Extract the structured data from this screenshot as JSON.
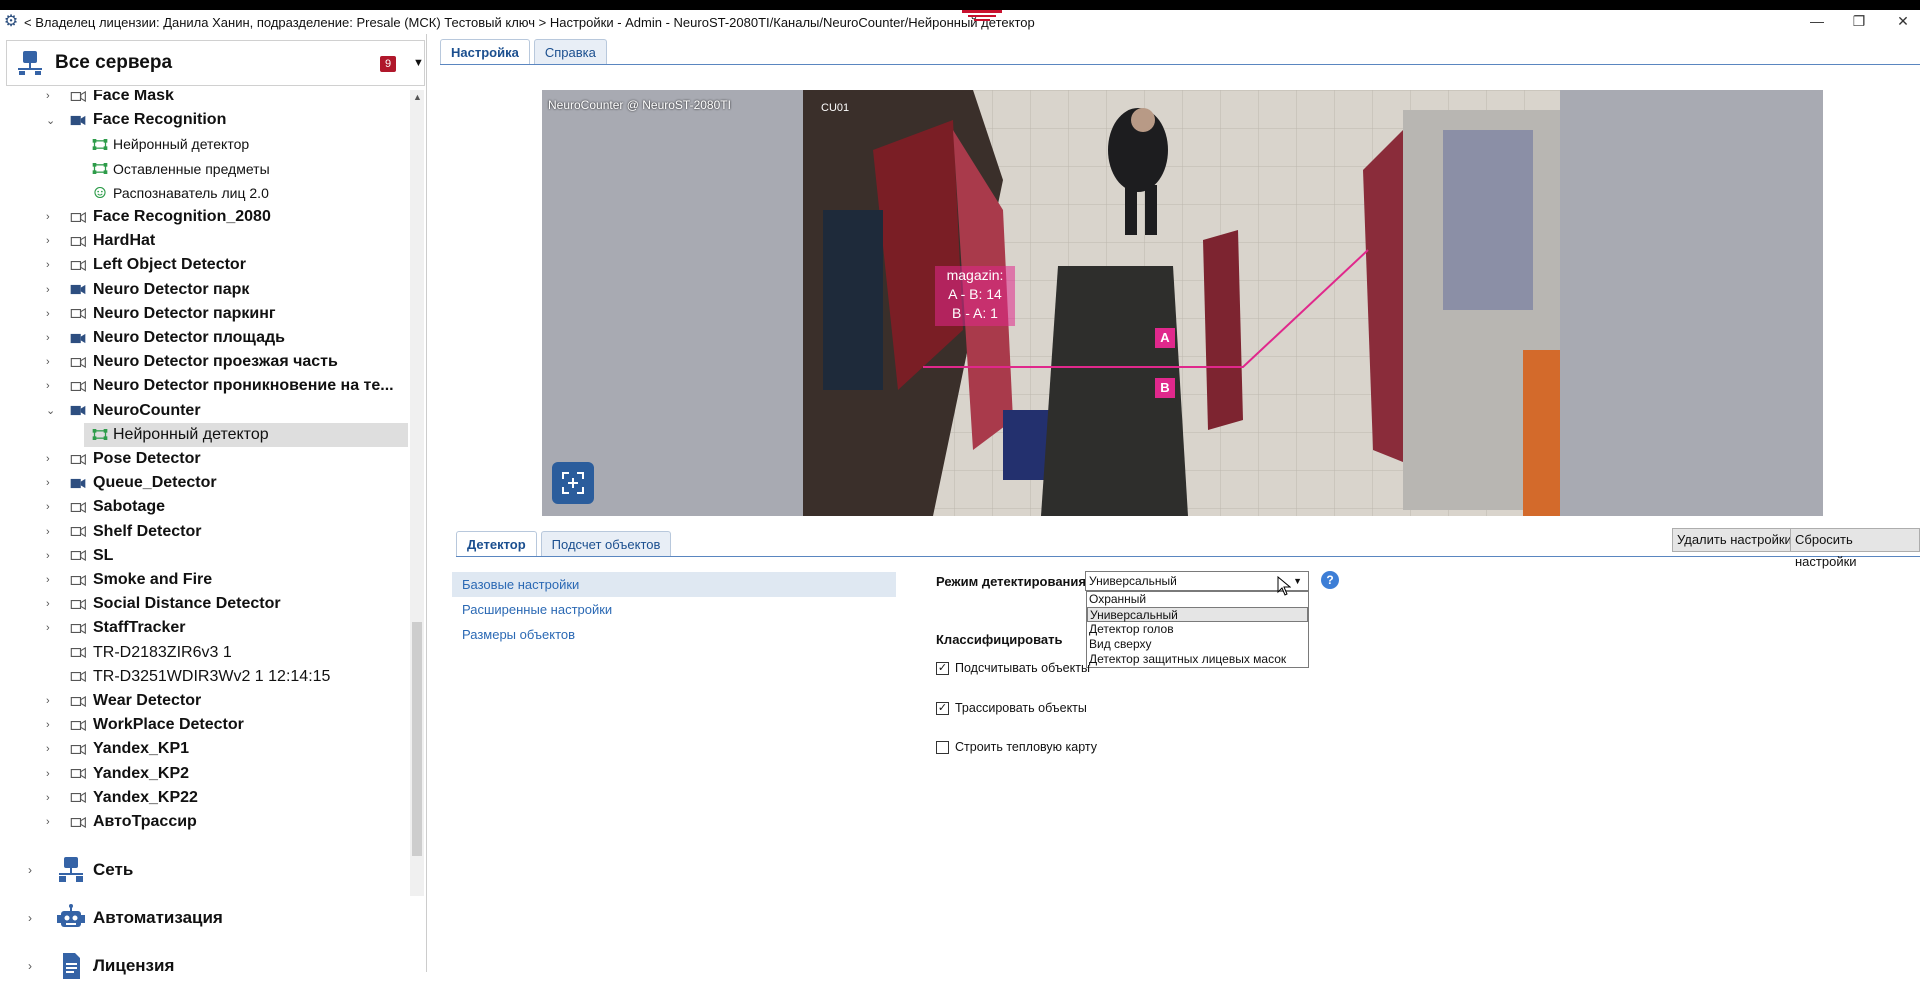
{
  "window": {
    "title": "< Владелец лицензии: Данила Ханин, подразделение: Presale (МСК) Тестовый ключ > Настройки - Admin - NeuroST-2080TI/Каналы/NeuroCounter/Нейронный детектор"
  },
  "sidebar": {
    "servers_label": "Все сервера",
    "badge": "9",
    "tree": [
      {
        "label": "Face Mask",
        "kind": "camera",
        "expanded": false
      },
      {
        "label": "Face Recognition",
        "kind": "camera",
        "expanded": true
      },
      {
        "label": "Нейронный детектор",
        "kind": "detector"
      },
      {
        "label": "Оставленные предметы",
        "kind": "detector"
      },
      {
        "label": "Распознаватель лиц 2.0",
        "kind": "face"
      },
      {
        "label": "Face Recognition_2080",
        "kind": "camera"
      },
      {
        "label": "HardHat",
        "kind": "camera"
      },
      {
        "label": "Left Object Detector",
        "kind": "camera"
      },
      {
        "label": "Neuro Detector парк",
        "kind": "camera"
      },
      {
        "label": "Neuro Detector паркинг",
        "kind": "camera"
      },
      {
        "label": "Neuro Detector площадь",
        "kind": "camera"
      },
      {
        "label": "Neuro Detector проезжая часть",
        "kind": "camera"
      },
      {
        "label": "Neuro Detector проникновение на те...",
        "kind": "camera"
      },
      {
        "label": "NeuroCounter",
        "kind": "camera",
        "expanded": true
      },
      {
        "label": "Нейронный детектор",
        "kind": "detector",
        "selected": true
      },
      {
        "label": "Pose Detector",
        "kind": "camera"
      },
      {
        "label": "Queue_Detector",
        "kind": "camera"
      },
      {
        "label": "Sabotage",
        "kind": "camera"
      },
      {
        "label": "Shelf Detector",
        "kind": "camera"
      },
      {
        "label": "SL",
        "kind": "camera"
      },
      {
        "label": "Smoke and Fire",
        "kind": "camera"
      },
      {
        "label": "Social Distance Detector",
        "kind": "camera"
      },
      {
        "label": "StaffTracker",
        "kind": "camera"
      },
      {
        "label": "TR-D2183ZIR6v3 1",
        "kind": "camera-plain"
      },
      {
        "label": "TR-D3251WDIR3Wv2 1 12:14:15",
        "kind": "camera-plain"
      },
      {
        "label": "Wear Detector",
        "kind": "camera"
      },
      {
        "label": "WorkPlace Detector",
        "kind": "camera"
      },
      {
        "label": "Yandex_KP1",
        "kind": "camera"
      },
      {
        "label": "Yandex_KP2",
        "kind": "camera"
      },
      {
        "label": "Yandex_KP22",
        "kind": "camera"
      },
      {
        "label": "АвтоТрассир",
        "kind": "camera"
      }
    ],
    "sections": [
      {
        "label": "Сеть",
        "icon": "network-icon"
      },
      {
        "label": "Автоматизация",
        "icon": "robot-icon"
      },
      {
        "label": "Лицензия",
        "icon": "license-icon"
      }
    ]
  },
  "main": {
    "tabs": [
      "Настройка",
      "Справка"
    ],
    "video": {
      "caption": "NeuroCounter @ NeuroST-2080TI",
      "cam_label": "CU01",
      "counter_name": "magazin:",
      "counter_ab": "A - B: 14",
      "counter_ba": "B - A: 1",
      "zone_a": "A",
      "zone_b": "B"
    },
    "sub_tabs": [
      "Детектор",
      "Подсчет объектов"
    ],
    "buttons": {
      "delete": "Удалить настройки",
      "reset": "Сбросить настройки"
    },
    "nav": [
      "Базовые настройки",
      "Расширенные настройки",
      "Размеры объектов"
    ],
    "form": {
      "mode_label": "Режим детектирования",
      "mode_value": "Универсальный",
      "options": [
        "Охранный",
        "Универсальный",
        "Детектор голов",
        "Вид сверху",
        "Детектор защитных лицевых масок"
      ],
      "classify_label": "Классифицировать",
      "count_label": "Подсчитывать объекты",
      "track_label": "Трассировать объекты",
      "heatmap_label": "Строить тепловую карту"
    }
  },
  "colors": {
    "accent": "#2b69b4",
    "badge": "#b0172b",
    "counter_line": "#e0288c"
  }
}
